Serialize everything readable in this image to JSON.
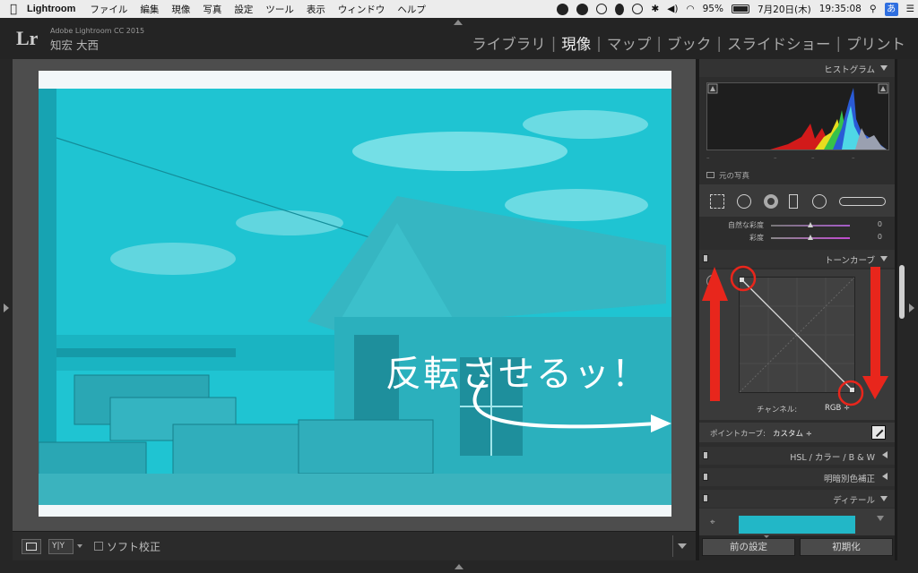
{
  "menubar": {
    "app": "Lightroom",
    "items": [
      "ファイル",
      "編集",
      "現像",
      "写真",
      "設定",
      "ツール",
      "表示",
      "ウィンドウ",
      "ヘルプ"
    ],
    "battery": "95%",
    "date": "7月20日(木)",
    "time": "19:35:08",
    "ime": "あ"
  },
  "identity": {
    "logo": "Lr",
    "product": "Adobe Lightroom CC 2015",
    "user": "知宏 大西"
  },
  "modules": {
    "library": "ライブラリ",
    "develop": "現像",
    "map": "マップ",
    "book": "ブック",
    "slideshow": "スライドショー",
    "print": "プリント",
    "separator": "|"
  },
  "photo": {
    "overlay_text": "反転させるッ！"
  },
  "toolbar": {
    "soft_proof": "ソフト校正"
  },
  "panel": {
    "histogram_title": "ヒストグラム",
    "original_photo": "元の写真",
    "vibrance_label": "自然な彩度",
    "vibrance_value": "0",
    "saturation_label": "彩度",
    "saturation_value": "0",
    "tone_curve_title": "トーンカーブ",
    "channel_label": "チャンネル:",
    "channel_value": "RGB ÷",
    "point_curve_label": "ポイントカーブ:",
    "point_curve_value": "カスタム ÷",
    "hsl_title": "HSL  /  カラー  /  B & W",
    "split_toning_title": "明暗別色補正",
    "detail_title": "ディテール",
    "previous_button": "前の設定",
    "reset_button": "初期化"
  },
  "colors": {
    "photo_tint": "#1bbfcc",
    "annotation_red": "#e8261c"
  }
}
